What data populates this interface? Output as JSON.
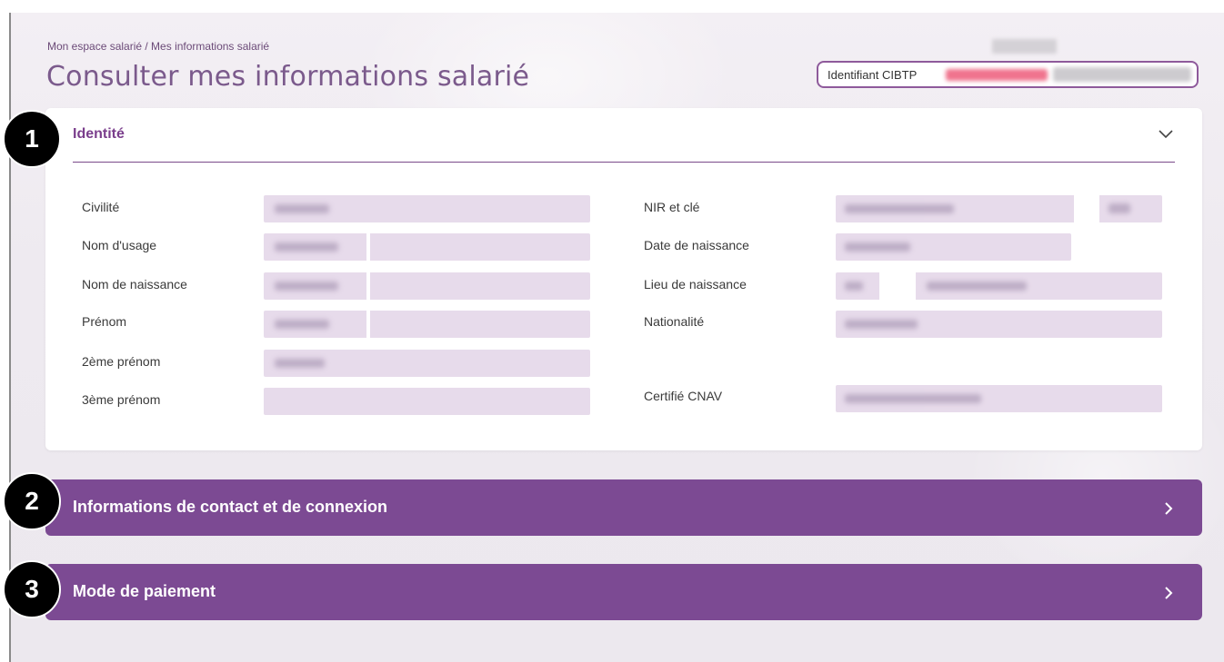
{
  "header": {
    "breadcrumb": "Mon espace salarié / Mes informations salarié",
    "title": "Consulter mes informations salarié",
    "identifier_label": "Identifiant CIBTP"
  },
  "identity": {
    "title": "Identité",
    "left_labels": [
      "Civilité",
      "Nom d'usage",
      "Nom de naissance",
      "Prénom",
      "2ème prénom",
      "3ème prénom"
    ],
    "right_labels": [
      "NIR et clé",
      "Date de naissance",
      "Lieu de naissance",
      "Nationalité",
      "Certifié CNAV"
    ]
  },
  "sections": [
    {
      "label": "Informations de contact et de connexion"
    },
    {
      "label": "Mode de paiement"
    }
  ],
  "badges": [
    "1",
    "2",
    "3"
  ],
  "colors": {
    "accent": "#7c4a93",
    "title_text": "#7b5a8c",
    "field_bg": "#e7dbeb",
    "identifier_redacted": "#f0748e"
  },
  "icons": {
    "identity_toggle": "chevron-down-icon",
    "section_toggle": "chevron-right-icon"
  }
}
